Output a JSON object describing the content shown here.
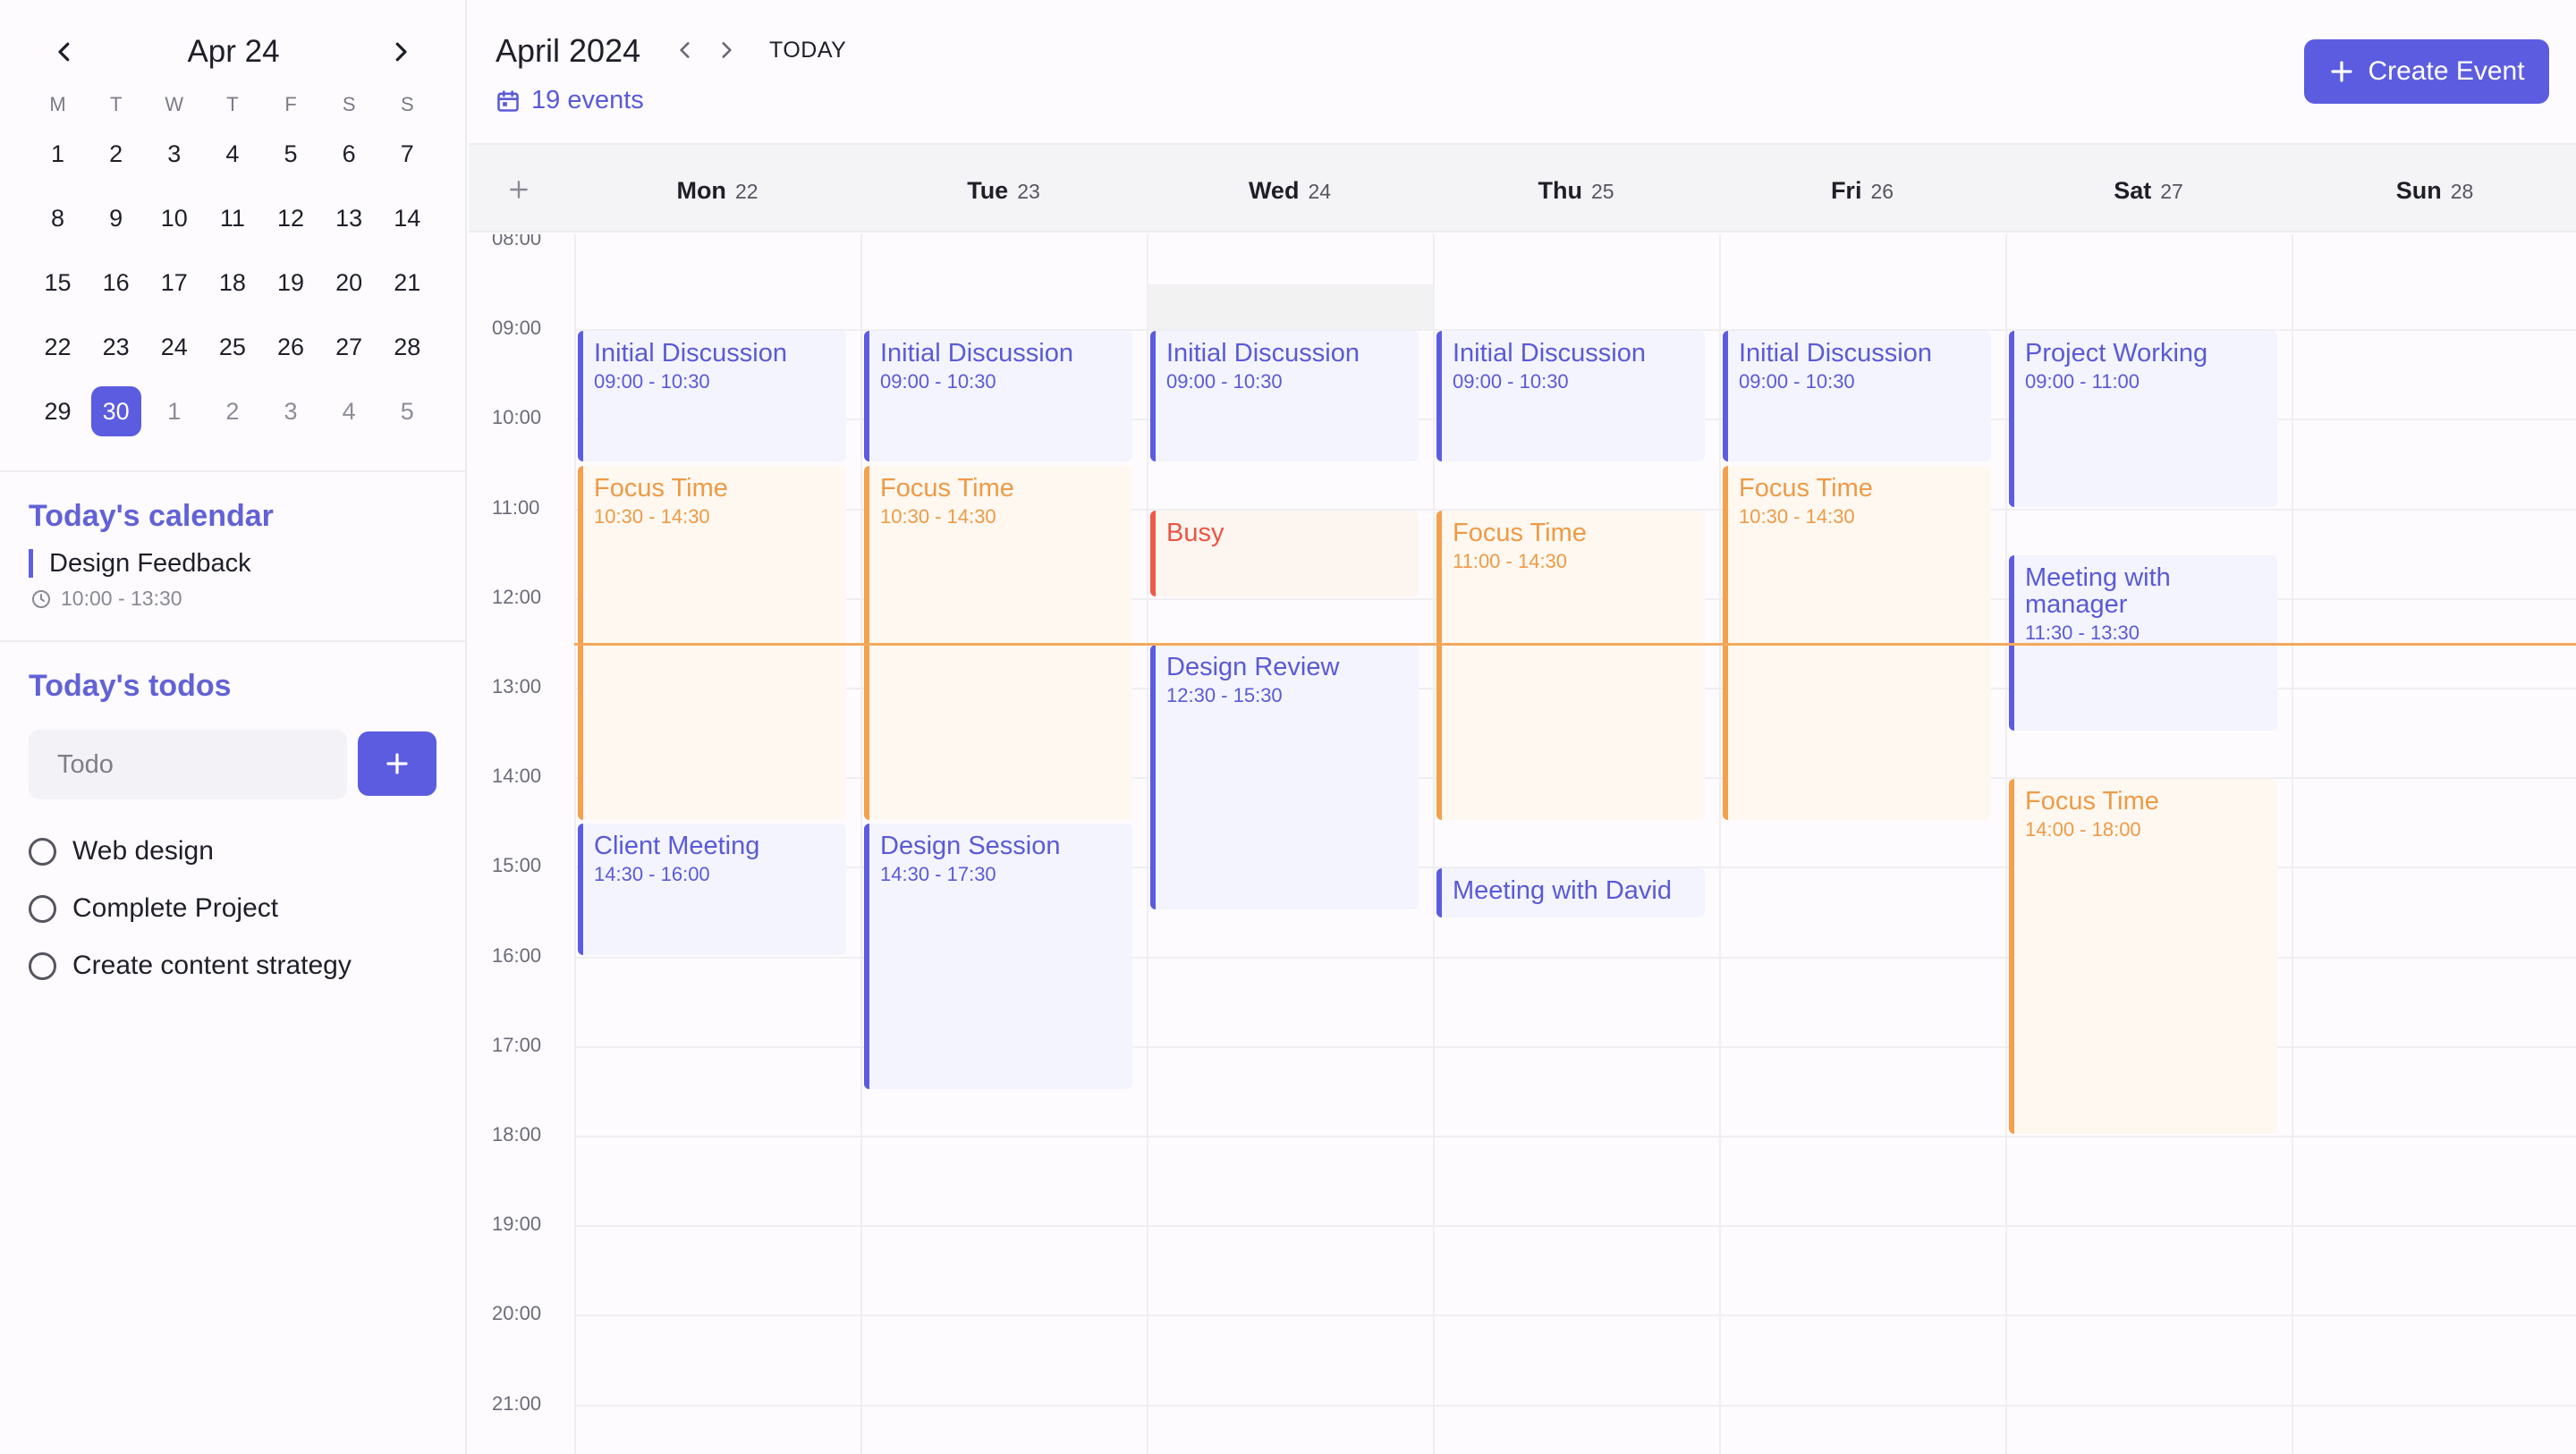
{
  "mini_calendar": {
    "month_label": "Apr 24",
    "weekdays": [
      "M",
      "T",
      "W",
      "T",
      "F",
      "S",
      "S"
    ],
    "weeks": [
      [
        "1",
        "2",
        "3",
        "4",
        "5",
        "6",
        "7"
      ],
      [
        "8",
        "9",
        "10",
        "11",
        "12",
        "13",
        "14"
      ],
      [
        "15",
        "16",
        "17",
        "18",
        "19",
        "20",
        "21"
      ],
      [
        "22",
        "23",
        "24",
        "25",
        "26",
        "27",
        "28"
      ],
      [
        "29",
        "30",
        "1",
        "2",
        "3",
        "4",
        "5"
      ]
    ],
    "selected": "30"
  },
  "today_calendar": {
    "heading": "Today's calendar",
    "event_title": "Design Feedback",
    "event_time": "10:00 - 13:30"
  },
  "todos": {
    "heading": "Today's todos",
    "placeholder": "Todo",
    "items": [
      "Web design",
      "Complete Project",
      "Create content strategy"
    ]
  },
  "header": {
    "month_title": "April 2024",
    "today_label": "TODAY",
    "events_count": "19 events",
    "create_label": "Create Event"
  },
  "week": {
    "days": [
      {
        "name": "Mon",
        "num": "22"
      },
      {
        "name": "Tue",
        "num": "23"
      },
      {
        "name": "Wed",
        "num": "24"
      },
      {
        "name": "Thu",
        "num": "25"
      },
      {
        "name": "Fri",
        "num": "26"
      },
      {
        "name": "Sat",
        "num": "27"
      },
      {
        "name": "Sun",
        "num": "28"
      }
    ],
    "hours": [
      "08:00",
      "09:00",
      "10:00",
      "11:00",
      "12:00",
      "13:00",
      "14:00",
      "15:00",
      "16:00",
      "17:00",
      "18:00",
      "19:00",
      "20:00",
      "21:00"
    ],
    "current_time": "12:30"
  },
  "events": [
    {
      "day": 0,
      "title": "Initial Discussion",
      "time": "09:00 - 10:30",
      "start": "09:00",
      "end": "10:30",
      "color": "blue"
    },
    {
      "day": 0,
      "title": "Focus Time",
      "time": "10:30 - 14:30",
      "start": "10:30",
      "end": "14:30",
      "color": "orange"
    },
    {
      "day": 0,
      "title": "Client Meeting",
      "time": "14:30 - 16:00",
      "start": "14:30",
      "end": "16:00",
      "color": "blue"
    },
    {
      "day": 1,
      "title": "Initial Discussion",
      "time": "09:00 - 10:30",
      "start": "09:00",
      "end": "10:30",
      "color": "blue"
    },
    {
      "day": 1,
      "title": "Focus Time",
      "time": "10:30 - 14:30",
      "start": "10:30",
      "end": "14:30",
      "color": "orange"
    },
    {
      "day": 1,
      "title": "Design Session",
      "time": "14:30 - 17:30",
      "start": "14:30",
      "end": "17:30",
      "color": "blue"
    },
    {
      "day": 2,
      "title": "Initial Discussion",
      "time": "09:00 - 10:30",
      "start": "09:00",
      "end": "10:30",
      "color": "blue"
    },
    {
      "day": 2,
      "title": "Busy",
      "time": "",
      "start": "11:00",
      "end": "12:00",
      "color": "red"
    },
    {
      "day": 2,
      "title": "Design Review",
      "time": "12:30 - 15:30",
      "start": "12:30",
      "end": "15:30",
      "color": "blue"
    },
    {
      "day": 3,
      "title": "Initial Discussion",
      "time": "09:00 - 10:30",
      "start": "09:00",
      "end": "10:30",
      "color": "blue"
    },
    {
      "day": 3,
      "title": "Focus Time",
      "time": "11:00 - 14:30",
      "start": "11:00",
      "end": "14:30",
      "color": "orange"
    },
    {
      "day": 3,
      "title": "Meeting with David",
      "time": "",
      "start": "15:00",
      "end": "15:35",
      "color": "blue"
    },
    {
      "day": 4,
      "title": "Initial Discussion",
      "time": "09:00 - 10:30",
      "start": "09:00",
      "end": "10:30",
      "color": "blue"
    },
    {
      "day": 4,
      "title": "Focus Time",
      "time": "10:30 - 14:30",
      "start": "10:30",
      "end": "14:30",
      "color": "orange"
    },
    {
      "day": 5,
      "title": "Project Working",
      "time": "09:00 - 11:00",
      "start": "09:00",
      "end": "11:00",
      "color": "blue"
    },
    {
      "day": 5,
      "title": "Meeting with manager",
      "time": "11:30 - 13:30",
      "start": "11:30",
      "end": "13:30",
      "color": "blue"
    },
    {
      "day": 5,
      "title": "Focus Time",
      "time": "14:00 - 18:00",
      "start": "14:00",
      "end": "18:00",
      "color": "orange"
    }
  ],
  "colors": {
    "accent": "#5c5ce0",
    "orange": "#f4a04d",
    "red": "#ee5a48"
  }
}
